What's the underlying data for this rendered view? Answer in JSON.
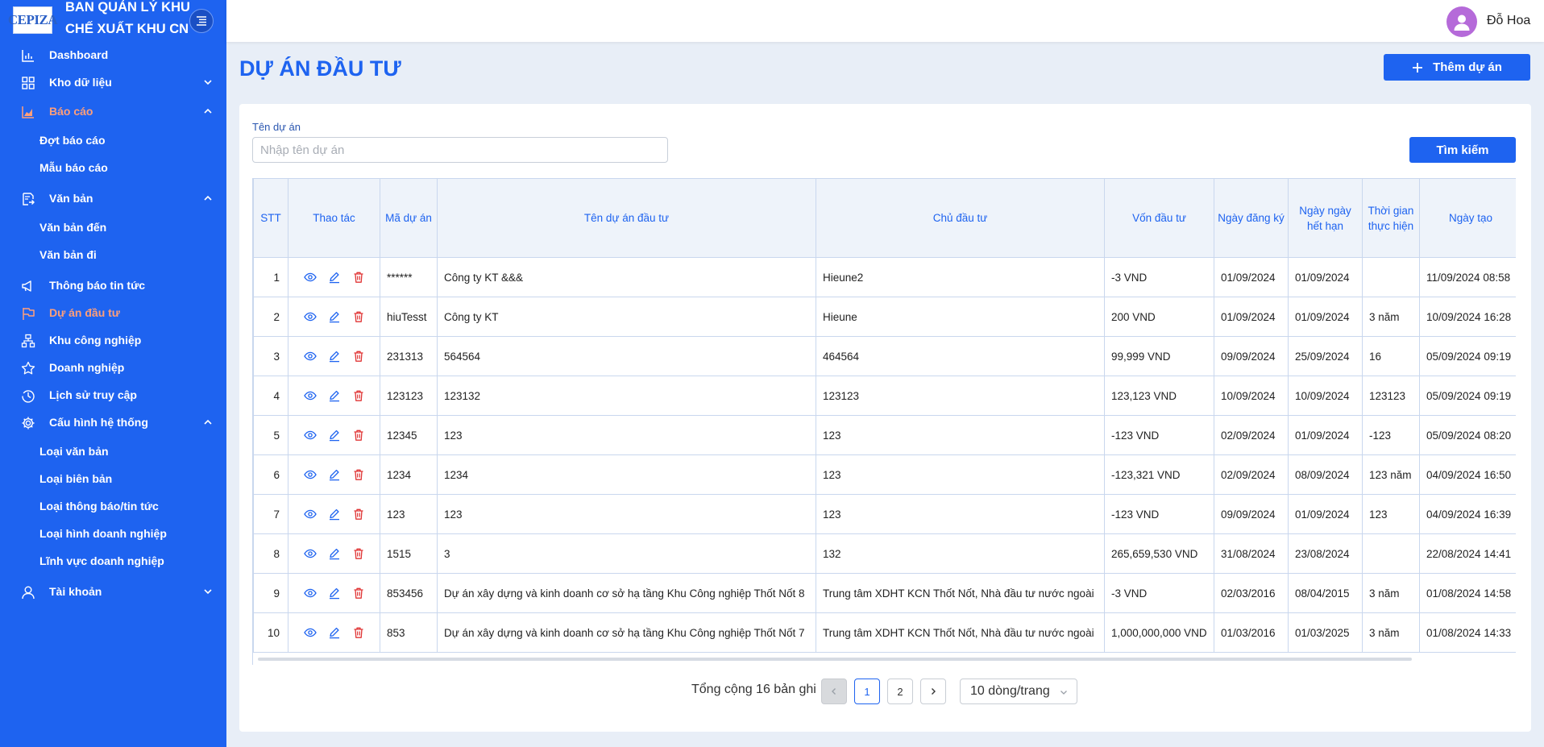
{
  "brand": {
    "logo_text": "CEPIZA",
    "title_line1": "BAN QUẢN LÝ KHU",
    "title_line2": "CHẾ XUẤT KHU CN"
  },
  "user": {
    "name": "Đỗ Hoa"
  },
  "sidebar": {
    "dashboard": "Dashboard",
    "kho_du_lieu": "Kho dữ liệu",
    "bao_cao": "Báo cáo",
    "dot_bao_cao": "Đợt báo cáo",
    "mau_bao_cao": "Mẫu báo cáo",
    "van_ban": "Văn bản",
    "van_ban_den": "Văn bản đến",
    "van_ban_di": "Văn bản đi",
    "thong_bao": "Thông báo tin tức",
    "du_an": "Dự án đầu tư",
    "khu_cong_nghiep": "Khu công nghiệp",
    "doanh_nghiep": "Doanh nghiệp",
    "lich_su": "Lịch sử truy cập",
    "cau_hinh": "Cấu hình hệ thống",
    "loai_van_ban": "Loại văn bản",
    "loai_bien_ban": "Loại biên bản",
    "loai_thong_bao": "Loại thông báo/tin tức",
    "loai_hinh_dn": "Loại hình doanh nghiệp",
    "linh_vuc_dn": "Lĩnh vực doanh nghiệp",
    "tai_khoan": "Tài khoản"
  },
  "page": {
    "title": "DỰ ÁN ĐẦU TƯ",
    "add_button": "Thêm dự án"
  },
  "filter": {
    "label": "Tên dự án",
    "placeholder": "Nhập tên dự án",
    "search_button": "Tìm kiếm"
  },
  "table": {
    "headers": {
      "stt": "STT",
      "thao_tac": "Thao tác",
      "ma_du_an": "Mã dự án",
      "ten_du_an": "Tên dự án đầu tư",
      "chu_dau_tu": "Chủ đầu tư",
      "von": "Vốn đầu tư",
      "ngay_dang_ky": "Ngày đăng ký",
      "ngay_het_han": "Ngày ngày hết hạn",
      "thoi_gian": "Thời gian thực hiện",
      "ngay_tao": "Ngày tạo"
    },
    "rows": [
      [
        "1",
        "******",
        "Công ty KT &&&",
        "Hieune2",
        "-3 VND",
        "01/09/2024",
        "01/09/2024",
        "",
        "11/09/2024 08:58"
      ],
      [
        "2",
        "hiuTesst",
        "Công ty KT",
        "Hieune",
        "200 VND",
        "01/09/2024",
        "01/09/2024",
        "3 năm",
        "10/09/2024 16:28"
      ],
      [
        "3",
        "231313",
        "564564",
        "464564",
        "99,999 VND",
        "09/09/2024",
        "25/09/2024",
        "16",
        "05/09/2024 09:19"
      ],
      [
        "4",
        "123123",
        "123132",
        "123123",
        "123,123 VND",
        "10/09/2024",
        "10/09/2024",
        "123123",
        "05/09/2024 09:19"
      ],
      [
        "5",
        "12345",
        "123",
        "123",
        "-123 VND",
        "02/09/2024",
        "01/09/2024",
        "-123",
        "05/09/2024 08:20"
      ],
      [
        "6",
        "1234",
        "1234",
        "123",
        "-123,321 VND",
        "02/09/2024",
        "08/09/2024",
        "123 năm",
        "04/09/2024 16:50"
      ],
      [
        "7",
        "123",
        "123",
        "123",
        "-123 VND",
        "09/09/2024",
        "01/09/2024",
        "123",
        "04/09/2024 16:39"
      ],
      [
        "8",
        "1515",
        "3",
        "132",
        "265,659,530 VND",
        "31/08/2024",
        "23/08/2024",
        "",
        "22/08/2024 14:41"
      ],
      [
        "9",
        "853456",
        "Dự án xây dựng và kinh doanh cơ sở hạ tầng Khu Công nghiệp Thốt Nốt 8",
        "Trung tâm XDHT KCN Thốt Nốt, Nhà đầu tư nước ngoài",
        "-3 VND",
        "02/03/2016",
        "08/04/2015",
        "3 năm",
        "01/08/2024 14:58"
      ],
      [
        "10",
        "853",
        "Dự án xây dựng và kinh doanh cơ sở hạ tầng Khu Công nghiệp Thốt Nốt 7",
        "Trung tâm XDHT KCN Thốt Nốt, Nhà đầu tư nước ngoài",
        "1,000,000,000 VND",
        "01/03/2016",
        "01/03/2025",
        "3 năm",
        "01/08/2024 14:33"
      ]
    ]
  },
  "pagination": {
    "total_text": "Tổng cộng 16 bản ghi",
    "pages": [
      "1",
      "2"
    ],
    "current": "1",
    "page_size": "10 dòng/trang"
  },
  "colors": {
    "primary": "#1e63f0",
    "active_nav": "#ff9f7a",
    "delete": "#e03434",
    "avatar": "#b56ad9"
  }
}
